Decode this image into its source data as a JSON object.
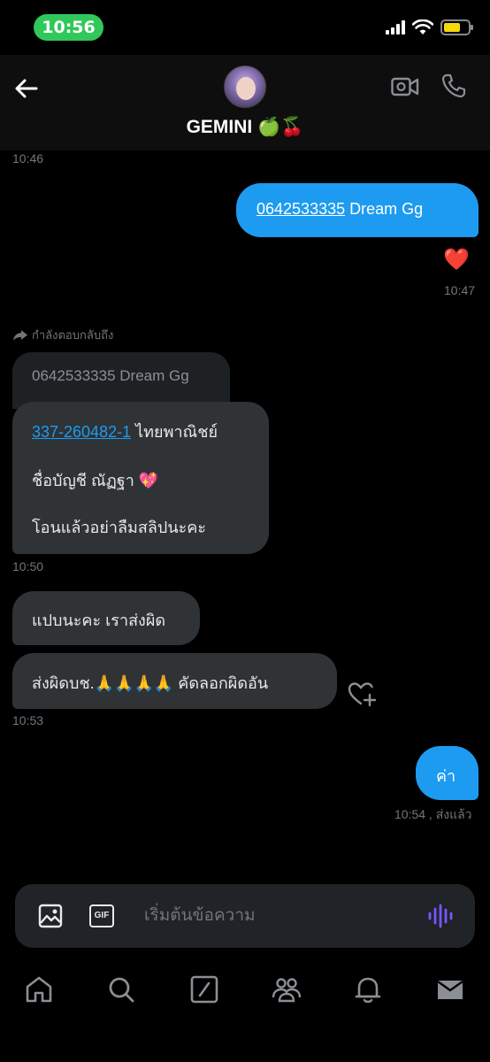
{
  "status_bar": {
    "time": "10:56"
  },
  "header": {
    "contact_name": "GEMINI 🍏🍒"
  },
  "messages": {
    "ts_1": "10:46",
    "sent_1": {
      "phone": "0642533335",
      "text": " Dream Gg"
    },
    "reaction": "❤️",
    "ts_2": "10:47",
    "replying_to": "กำลังตอบกลับถึง",
    "quoted_text": "0642533335 Dream Gg",
    "recv_1": {
      "account_number": "337-260482-1",
      "bank": " ไทยพาณิชย์",
      "account_name": "ชื่อบัญชี ณัฏฐา 💖",
      "reminder": "โอนแล้วอย่าลืมสลิปนะคะ"
    },
    "ts_3": "10:50",
    "recv_2": "แปบนะคะ เราส่งผิด",
    "recv_3": "ส่งผิดบช.🙏🙏🙏🙏 คัดลอกผิดอัน",
    "ts_4": "10:53",
    "sent_2": "ค่า",
    "ts_5": "10:54 , ส่งแล้ว"
  },
  "composer": {
    "placeholder": "เริ่มต้นข้อความ",
    "gif_label": "GIF"
  },
  "nav": {
    "items": [
      "home-icon",
      "search-icon",
      "compose-icon",
      "communities-icon",
      "notifications-icon",
      "messages-icon"
    ]
  },
  "colors": {
    "accent": "#1d9bf0",
    "bubble_received": "#2f3336",
    "background": "#000000",
    "voice_icon": "#7856ff"
  }
}
